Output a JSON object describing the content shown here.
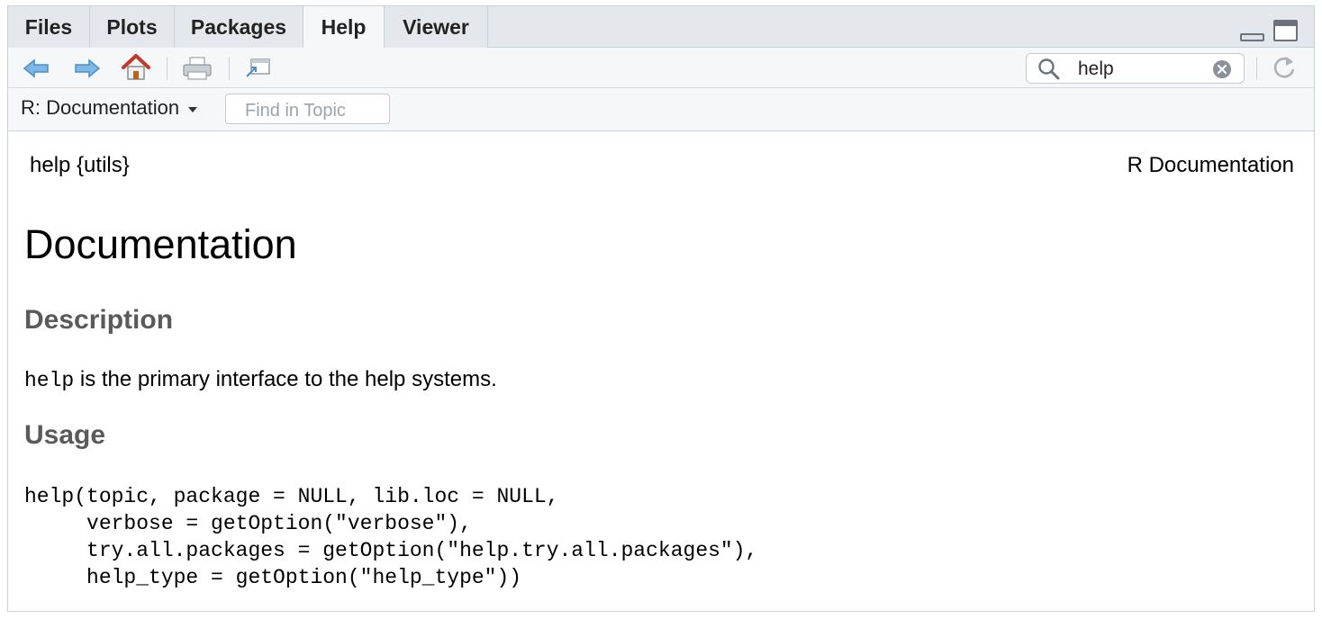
{
  "tabs": [
    {
      "label": "Files",
      "active": false
    },
    {
      "label": "Plots",
      "active": false
    },
    {
      "label": "Packages",
      "active": false
    },
    {
      "label": "Help",
      "active": true
    },
    {
      "label": "Viewer",
      "active": false
    }
  ],
  "toolbar": {
    "icons": [
      "back-arrow-icon",
      "forward-arrow-icon",
      "home-icon",
      "print-icon",
      "open-in-window-icon",
      "refresh-icon"
    ],
    "search": {
      "value": "help",
      "icon": "search-icon",
      "clear_icon": "clear-icon"
    }
  },
  "topic_bar": {
    "selected_topic": "R: Documentation",
    "find_placeholder": "Find in Topic"
  },
  "doc": {
    "header_left": "help {utils}",
    "header_right": "R Documentation",
    "title": "Documentation",
    "description_heading": "Description",
    "description_code": "help",
    "description_text": " is the primary interface to the help systems.",
    "usage_heading": "Usage",
    "usage_code": "help(topic, package = NULL, lib.loc = NULL,\n     verbose = getOption(\"verbose\"),\n     try.all.packages = getOption(\"help.try.all.packages\"),\n     help_type = getOption(\"help_type\"))"
  },
  "colors": {
    "tab_bg": "#e4e8ec",
    "active_tab_bg": "#f5f7f9",
    "border": "#c9d1da",
    "arrow_blue": "#5aa0d6",
    "home_red": "#c0392b",
    "heading_gray": "#5a5a5a"
  }
}
